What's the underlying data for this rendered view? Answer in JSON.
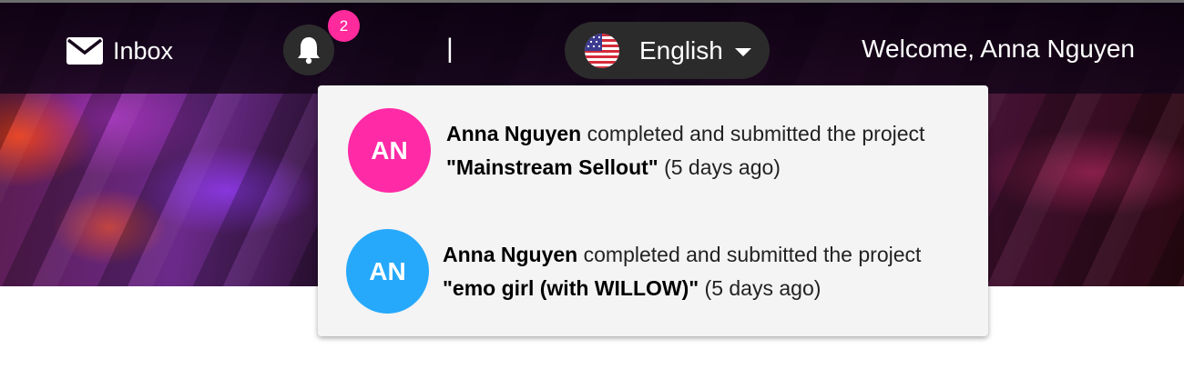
{
  "colors": {
    "badge": "#ff2a9c",
    "avatar_1": "#ff2aa6",
    "avatar_2": "#27a9fb",
    "dropdown_bg": "#f4f4f4",
    "pill_bg": "#2b2b2b"
  },
  "header": {
    "inbox_label": "Inbox",
    "inbox_icon": "envelope-icon",
    "bell_icon": "bell-icon",
    "notification_count": "2",
    "divider": "|",
    "language": "English",
    "language_flag": "us-flag-icon",
    "welcome": "Welcome, Anna Nguyen"
  },
  "notifications": [
    {
      "initials": "AN",
      "user": "Anna Nguyen",
      "action": "completed and submitted the project",
      "project": "\"Mainstream Sellout\"",
      "time": "(5 days ago)"
    },
    {
      "initials": "AN",
      "user": "Anna Nguyen",
      "action": "completed and submitted the project",
      "project": "\"emo girl (with WILLOW)\"",
      "time": "(5 days ago)"
    }
  ]
}
